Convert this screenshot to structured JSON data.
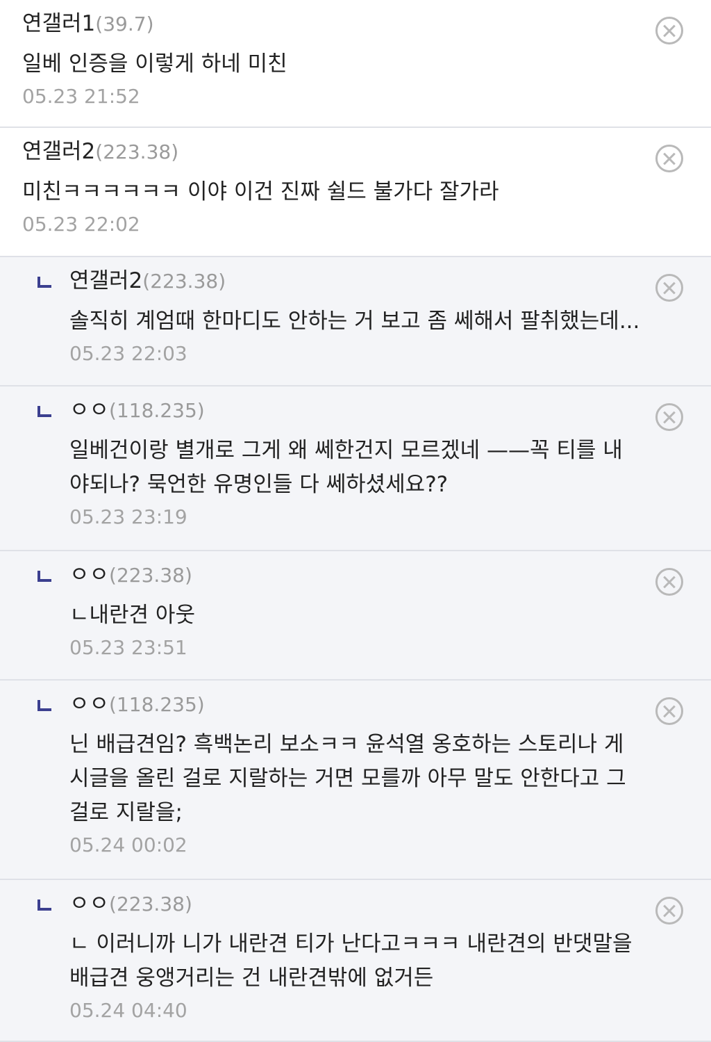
{
  "comments": [
    {
      "nickname": "연갤러1",
      "ip": "(39.7)",
      "text": "일베 인증을 이렇게 하네 미친",
      "time": "05.23 21:52",
      "reply": false
    },
    {
      "nickname": "연갤러2",
      "ip": "(223.38)",
      "text": "미친ㅋㅋㅋㅋㅋㅋ 이야 이건 진짜 쉴드 불가다 잘가라",
      "time": "05.23 22:02",
      "reply": false
    },
    {
      "nickname": "연갤러2",
      "ip": "(223.38)",
      "text": "솔직히 계엄때 한마디도 안하는 거 보고 좀 쎄해서 팔취했는데...",
      "time": "05.23 22:03",
      "reply": true
    },
    {
      "nickname": "ㅇㅇ",
      "ip": "(118.235)",
      "text": "일베건이랑 별개로 그게 왜 쎄한건지 모르겠네 ——꼭 티를 내야되나? 묵언한 유명인들 다 쎄하셨세요??",
      "time": "05.23 23:19",
      "reply": true
    },
    {
      "nickname": "ㅇㅇ",
      "ip": "(223.38)",
      "text": "ㄴ내란견 아웃",
      "time": "05.23 23:51",
      "reply": true
    },
    {
      "nickname": "ㅇㅇ",
      "ip": "(118.235)",
      "text": "닌 배급견임? 흑백논리 보소ㅋㅋ 윤석열 옹호하는 스토리나 게시글을 올린 걸로 지랄하는 거면 모를까 아무 말도 안한다고 그걸로 지랄을;",
      "time": "05.24 00:02",
      "reply": true
    },
    {
      "nickname": "ㅇㅇ",
      "ip": "(223.38)",
      "text": "ㄴ 이러니까 니가 내란견 티가 난다고ㅋㅋㅋ 내란견의 반댓말을 배급견 웅앵거리는 건 내란견밖에 없거든",
      "time": "05.24 04:40",
      "reply": true
    }
  ],
  "icons": {
    "reply_marker": "reply-arrow-icon",
    "delete": "close-circle-icon"
  },
  "colors": {
    "reply_background": "#f4f5f8",
    "reply_marker": "#3b3f8f",
    "divider": "#dfe1e7",
    "meta_text": "#a3a3a3"
  }
}
